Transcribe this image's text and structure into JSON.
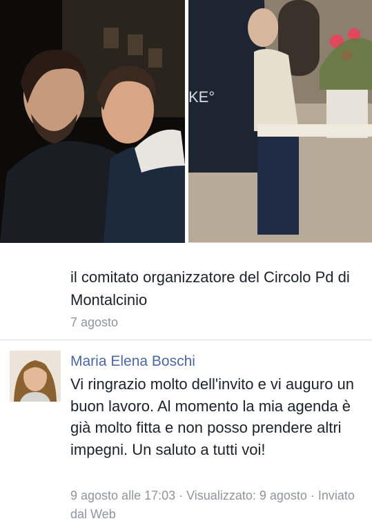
{
  "previous_message": {
    "text": "il comitato organizzatore del Circolo Pd di Montalcinio",
    "date": "7 agosto"
  },
  "reply": {
    "sender": "Maria Elena Boschi",
    "text": "Vi ringrazio molto dell'invito e vi auguro un buon lavoro. Al momento la mia agenda è già molto fitta e non posso prendere altri impegni. Un saluto a tutti voi!",
    "meta": "9 agosto alle 17:03 · Visualizzato: 9 agosto · Inviato dal Web"
  },
  "colors": {
    "sender_name": "#4b67a1",
    "body_text": "#1d2129",
    "meta_text": "#90949c",
    "divider": "#dddfe2"
  },
  "images": {
    "left_photo": "couple-night-photo",
    "right_photo": "elderly-man-cafe-photo",
    "avatar": "profile-photo"
  }
}
